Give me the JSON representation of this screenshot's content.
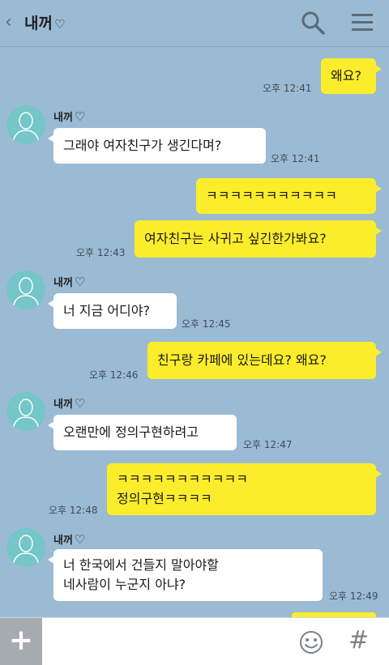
{
  "header": {
    "title": "내꺼",
    "heart": "♡"
  },
  "messages": [
    {
      "text": "왜요?",
      "time": "오후 12:41"
    },
    {
      "sender": "내꺼",
      "text": "그래야 여자친구가 생긴다며?",
      "time": "오후 12:41"
    },
    {
      "text": "ㅋㅋㅋㅋㅋㅋㅋㅋㅋㅋㅋ"
    },
    {
      "text": "여자친구는 사귀고 싶긴한가봐요?",
      "time": "오후 12:43"
    },
    {
      "sender": "내꺼",
      "text": "너 지금 어디야?",
      "time": "오후 12:45"
    },
    {
      "text": "친구랑 카페에 있는데요? 왜요?",
      "time": "오후 12:46"
    },
    {
      "sender": "내꺼",
      "text": "오랜만에 정의구현하려고",
      "time": "오후 12:47"
    },
    {
      "lines": [
        "ㅋㅋㅋㅋㅋㅋㅋㅋㅋㅋㅋ",
        "정의구현ㅋㅋㅋㅋ"
      ],
      "time": "오후 12:48"
    },
    {
      "sender": "내꺼",
      "lines": [
        "너 한국에서 건들지 말아야할",
        "네사람이 누군지 아냐?"
      ],
      "time": "오후 12:49"
    }
  ],
  "input_bar": {
    "plus": "+",
    "hash": "#"
  }
}
